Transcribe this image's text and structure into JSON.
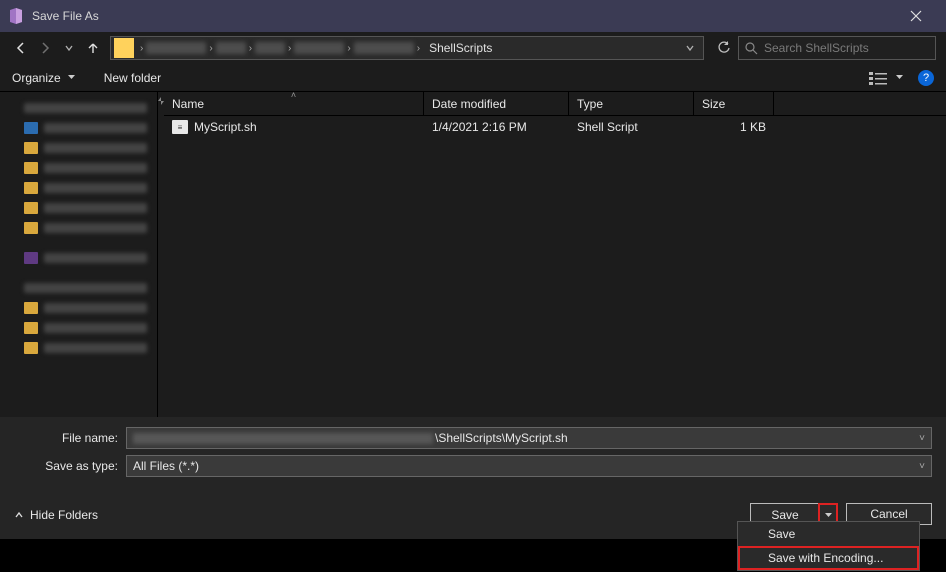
{
  "window": {
    "title": "Save File As"
  },
  "nav": {
    "path_segment": "ShellScripts"
  },
  "search": {
    "placeholder": "Search ShellScripts"
  },
  "toolbar": {
    "organize": "Organize",
    "new_folder": "New folder"
  },
  "columns": {
    "name": "Name",
    "date": "Date modified",
    "type": "Type",
    "size": "Size"
  },
  "files": [
    {
      "name": "MyScript.sh",
      "date": "1/4/2021 2:16 PM",
      "type": "Shell Script",
      "size": "1 KB"
    }
  ],
  "fields": {
    "file_name_label": "File name:",
    "file_name_value": "\\ShellScripts\\MyScript.sh",
    "save_type_label": "Save as type:",
    "save_type_value": "All Files (*.*)"
  },
  "footer": {
    "hide_folders": "Hide Folders",
    "save": "Save",
    "cancel": "Cancel"
  },
  "menu": {
    "save": "Save",
    "save_with_encoding": "Save with Encoding..."
  }
}
